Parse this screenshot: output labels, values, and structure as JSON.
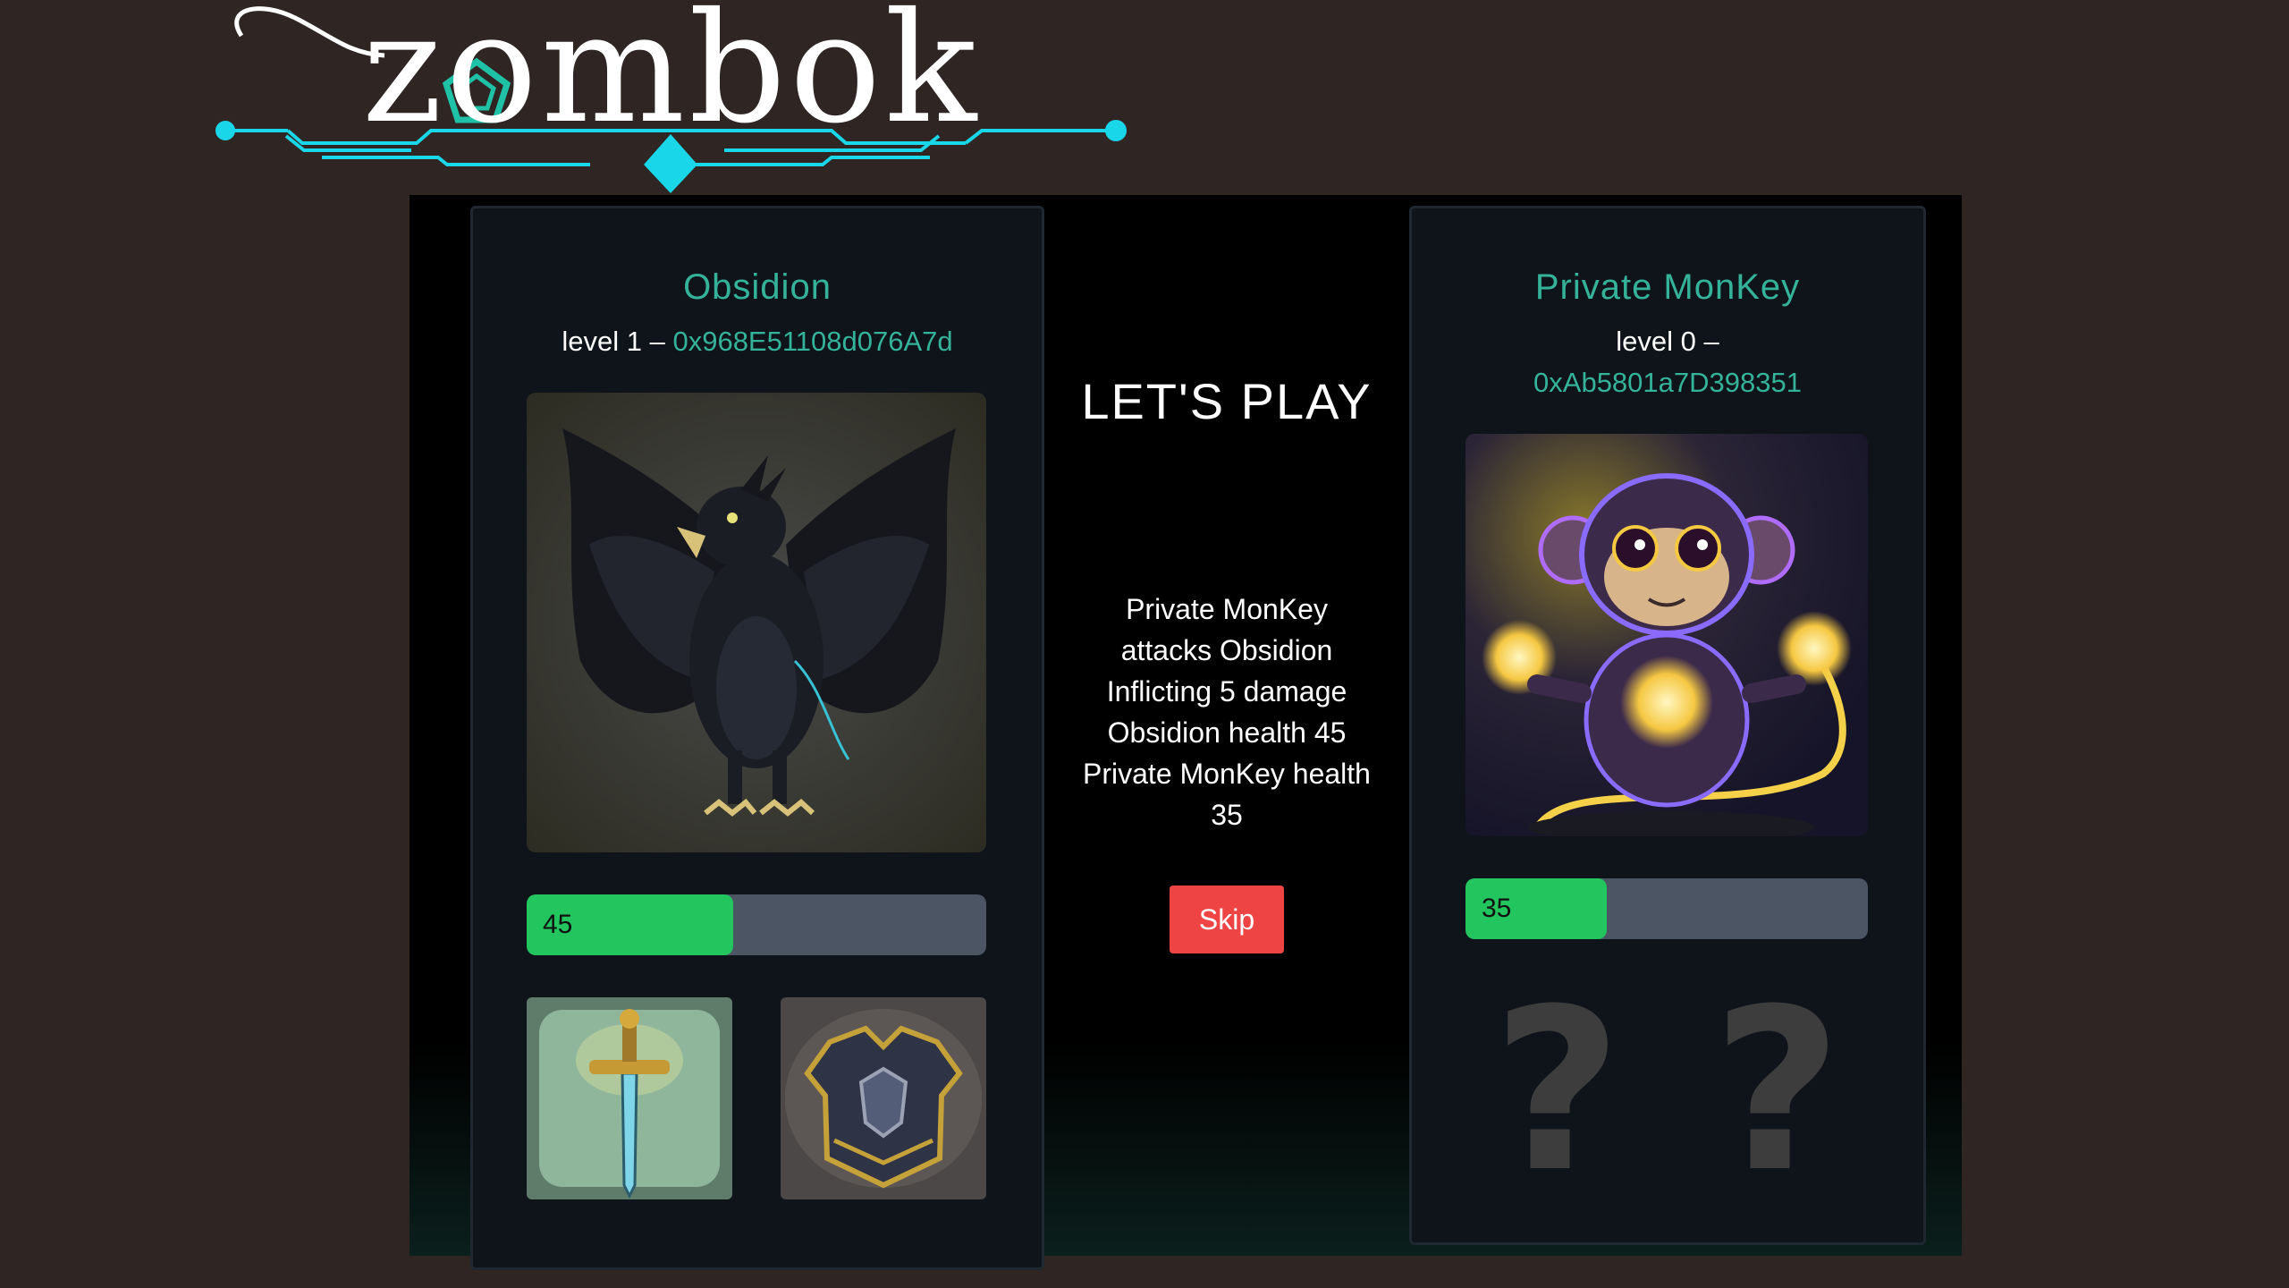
{
  "logo": {
    "text": "zombok"
  },
  "player": {
    "name": "Obsidion",
    "level_label": "level 1",
    "separator": "–",
    "address": "0x968E51108d076A7d",
    "health": 45,
    "health_fraction": 0.45,
    "portrait_icon": "black-eagle-creature",
    "items": [
      {
        "icon": "sword-icon"
      },
      {
        "icon": "armor-icon"
      }
    ]
  },
  "opponent": {
    "name": "Private MonKey",
    "level_label": "level 0",
    "separator": "–",
    "address": "0xAb5801a7D398351",
    "health": 35,
    "health_fraction": 0.35,
    "portrait_icon": "glowing-monkey-creature",
    "items": [
      {
        "icon": "question-mark",
        "text": "?"
      },
      {
        "icon": "question-mark",
        "text": "?"
      }
    ]
  },
  "center": {
    "headline": "LET'S PLAY",
    "battle_log": "Private MonKey attacks Obsidion Inflicting 5 damage Obsidion health 45 Private MonKey health 35",
    "skip_label": "Skip"
  },
  "colors": {
    "background": "#2f2624",
    "accent_teal": "#34b39a",
    "logo_cyan": "#19d6e8",
    "health_green": "#22c55e",
    "skip_red": "#ef4444"
  }
}
